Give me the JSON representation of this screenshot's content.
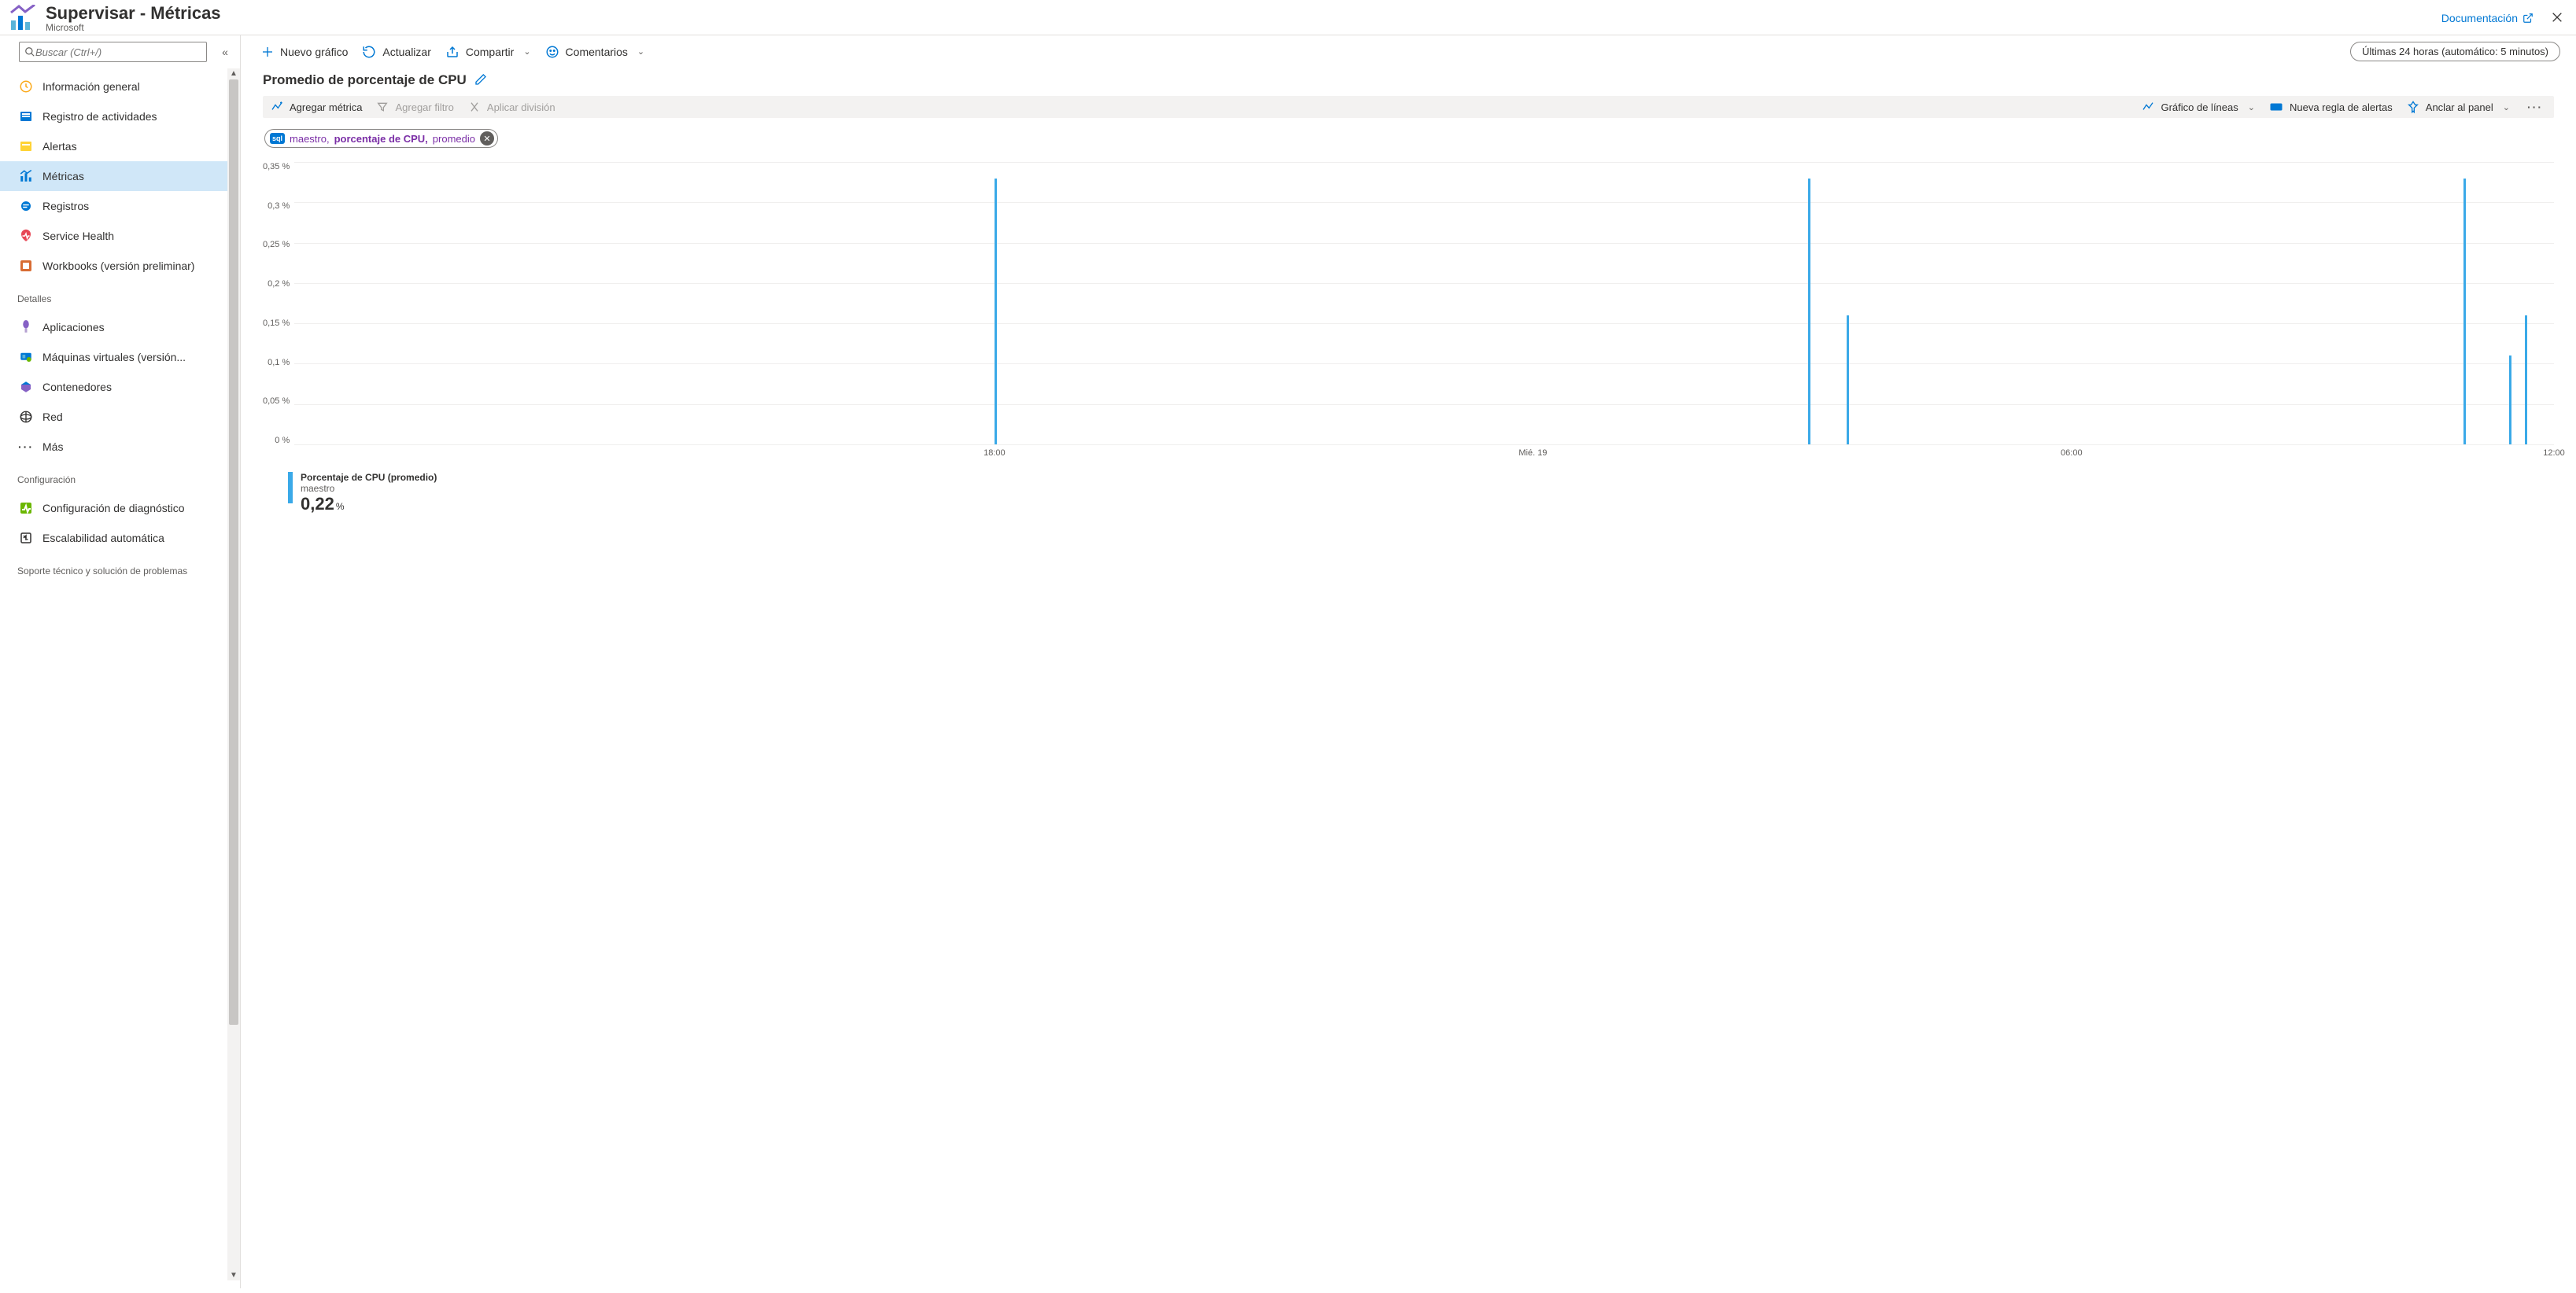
{
  "header": {
    "title": "Supervisar - Métricas",
    "subtitle": "Microsoft",
    "docs_link": "Documentación"
  },
  "sidebar": {
    "search_placeholder": "Buscar (Ctrl+/)",
    "items_top": [
      {
        "label": "Información general"
      },
      {
        "label": "Registro de actividades"
      },
      {
        "label": "Alertas"
      },
      {
        "label": "Métricas",
        "selected": true
      },
      {
        "label": "Registros"
      },
      {
        "label": "Service Health"
      },
      {
        "label": "Workbooks (versión preliminar)"
      }
    ],
    "section_details": "Detalles",
    "items_details": [
      {
        "label": "Aplicaciones"
      },
      {
        "label": "Máquinas virtuales (versión..."
      },
      {
        "label": "Contenedores"
      },
      {
        "label": "Red"
      },
      {
        "label": "Más"
      }
    ],
    "section_config": "Configuración",
    "items_config": [
      {
        "label": "Configuración de diagnóstico"
      },
      {
        "label": "Escalabilidad automática"
      }
    ],
    "section_support": "Soporte técnico y solución de problemas"
  },
  "toolbar": {
    "new_chart": "Nuevo gráfico",
    "refresh": "Actualizar",
    "share": "Compartir",
    "feedback": "Comentarios",
    "timerange": "Últimas 24 horas (automático: 5 minutos)"
  },
  "chart": {
    "title": "Promedio de porcentaje de CPU",
    "toolbar": {
      "add_metric": "Agregar métrica",
      "add_filter": "Agregar filtro",
      "apply_split": "Aplicar división",
      "chart_type": "Gráfico de líneas",
      "new_alert_rule": "Nueva regla de alertas",
      "pin": "Anclar al panel"
    },
    "pill": {
      "resource": "maestro,",
      "metric": "porcentaje de CPU,",
      "agg": "promedio"
    },
    "legend": {
      "line1": "Porcentaje de CPU (promedio)",
      "line2": "maestro",
      "value": "0,22",
      "unit": "%"
    }
  },
  "chart_data": {
    "type": "line",
    "title": "Promedio de porcentaje de CPU",
    "ylabel": "",
    "xlabel": "",
    "ylim": [
      0,
      0.35
    ],
    "y_ticks": [
      "0,35 %",
      "0,3 %",
      "0,25 %",
      "0,2 %",
      "0,15 %",
      "0,1 %",
      "0,05 %",
      "0 %"
    ],
    "x_ticks": [
      {
        "pos_pct": 30.5,
        "label": "18:00"
      },
      {
        "pos_pct": 54.5,
        "label": "Mié. 19"
      },
      {
        "pos_pct": 78.5,
        "label": "06:00"
      },
      {
        "pos_pct": 100.0,
        "label": "12:00"
      }
    ],
    "spikes": [
      {
        "x_pct": 31.0,
        "value": 0.33
      },
      {
        "x_pct": 67.0,
        "value": 0.33
      },
      {
        "x_pct": 68.7,
        "value": 0.16
      },
      {
        "x_pct": 96.0,
        "value": 0.33
      },
      {
        "x_pct": 98.0,
        "value": 0.11
      },
      {
        "x_pct": 98.7,
        "value": 0.16
      }
    ],
    "series": [
      {
        "name": "Porcentaje de CPU (promedio) — maestro",
        "avg_value_label": "0,22 %"
      }
    ]
  }
}
